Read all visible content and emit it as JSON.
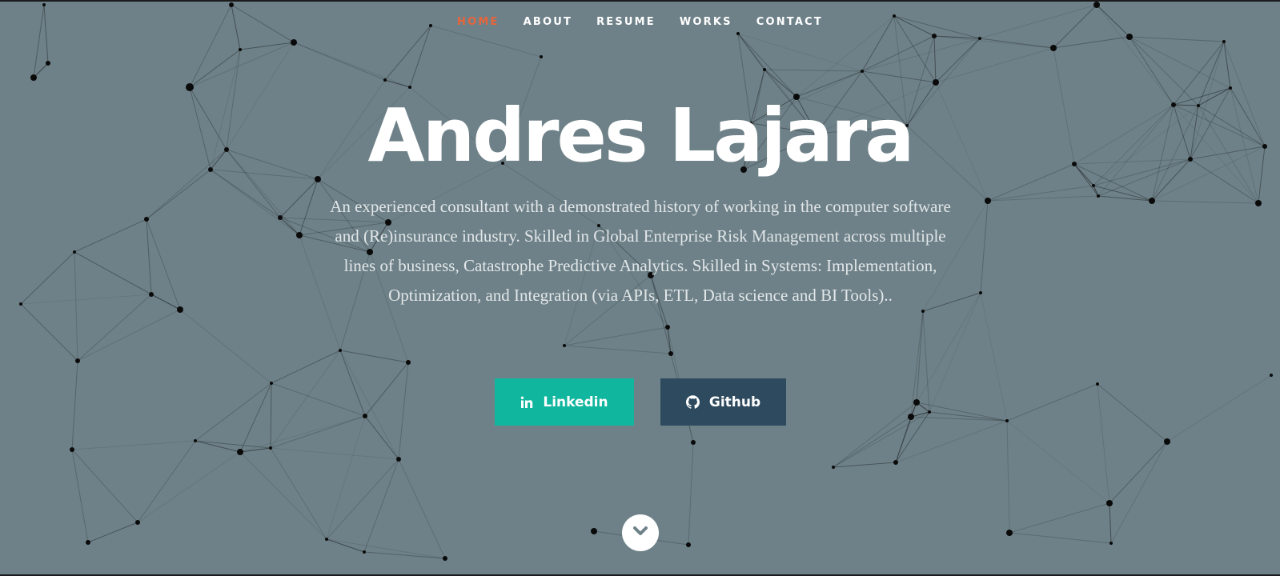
{
  "nav": {
    "items": [
      {
        "label": "HOME",
        "active": true
      },
      {
        "label": "ABOUT",
        "active": false
      },
      {
        "label": "RESUME",
        "active": false
      },
      {
        "label": "WORKS",
        "active": false
      },
      {
        "label": "CONTACT",
        "active": false
      }
    ]
  },
  "hero": {
    "title": "Andres Lajara",
    "bio": "An experienced consultant with a demonstrated history of working in the computer software and (Re)insurance industry. Skilled in Global Enterprise Risk Management across multiple lines of business, Catastrophe Predictive Analytics. Skilled in Systems: Implementation, Optimization, and Integration (via APIs, ETL, Data science and BI Tools)..",
    "buttons": [
      {
        "label": "Linkedin",
        "icon": "linkedin-icon",
        "color": "#11b69e"
      },
      {
        "label": "Github",
        "icon": "github-icon",
        "color": "#2e4a5f"
      }
    ],
    "scroll_icon": "chevron-down-icon"
  },
  "colors": {
    "background": "#6e8188",
    "accent": "#e8643a",
    "text": "#ffffff"
  }
}
